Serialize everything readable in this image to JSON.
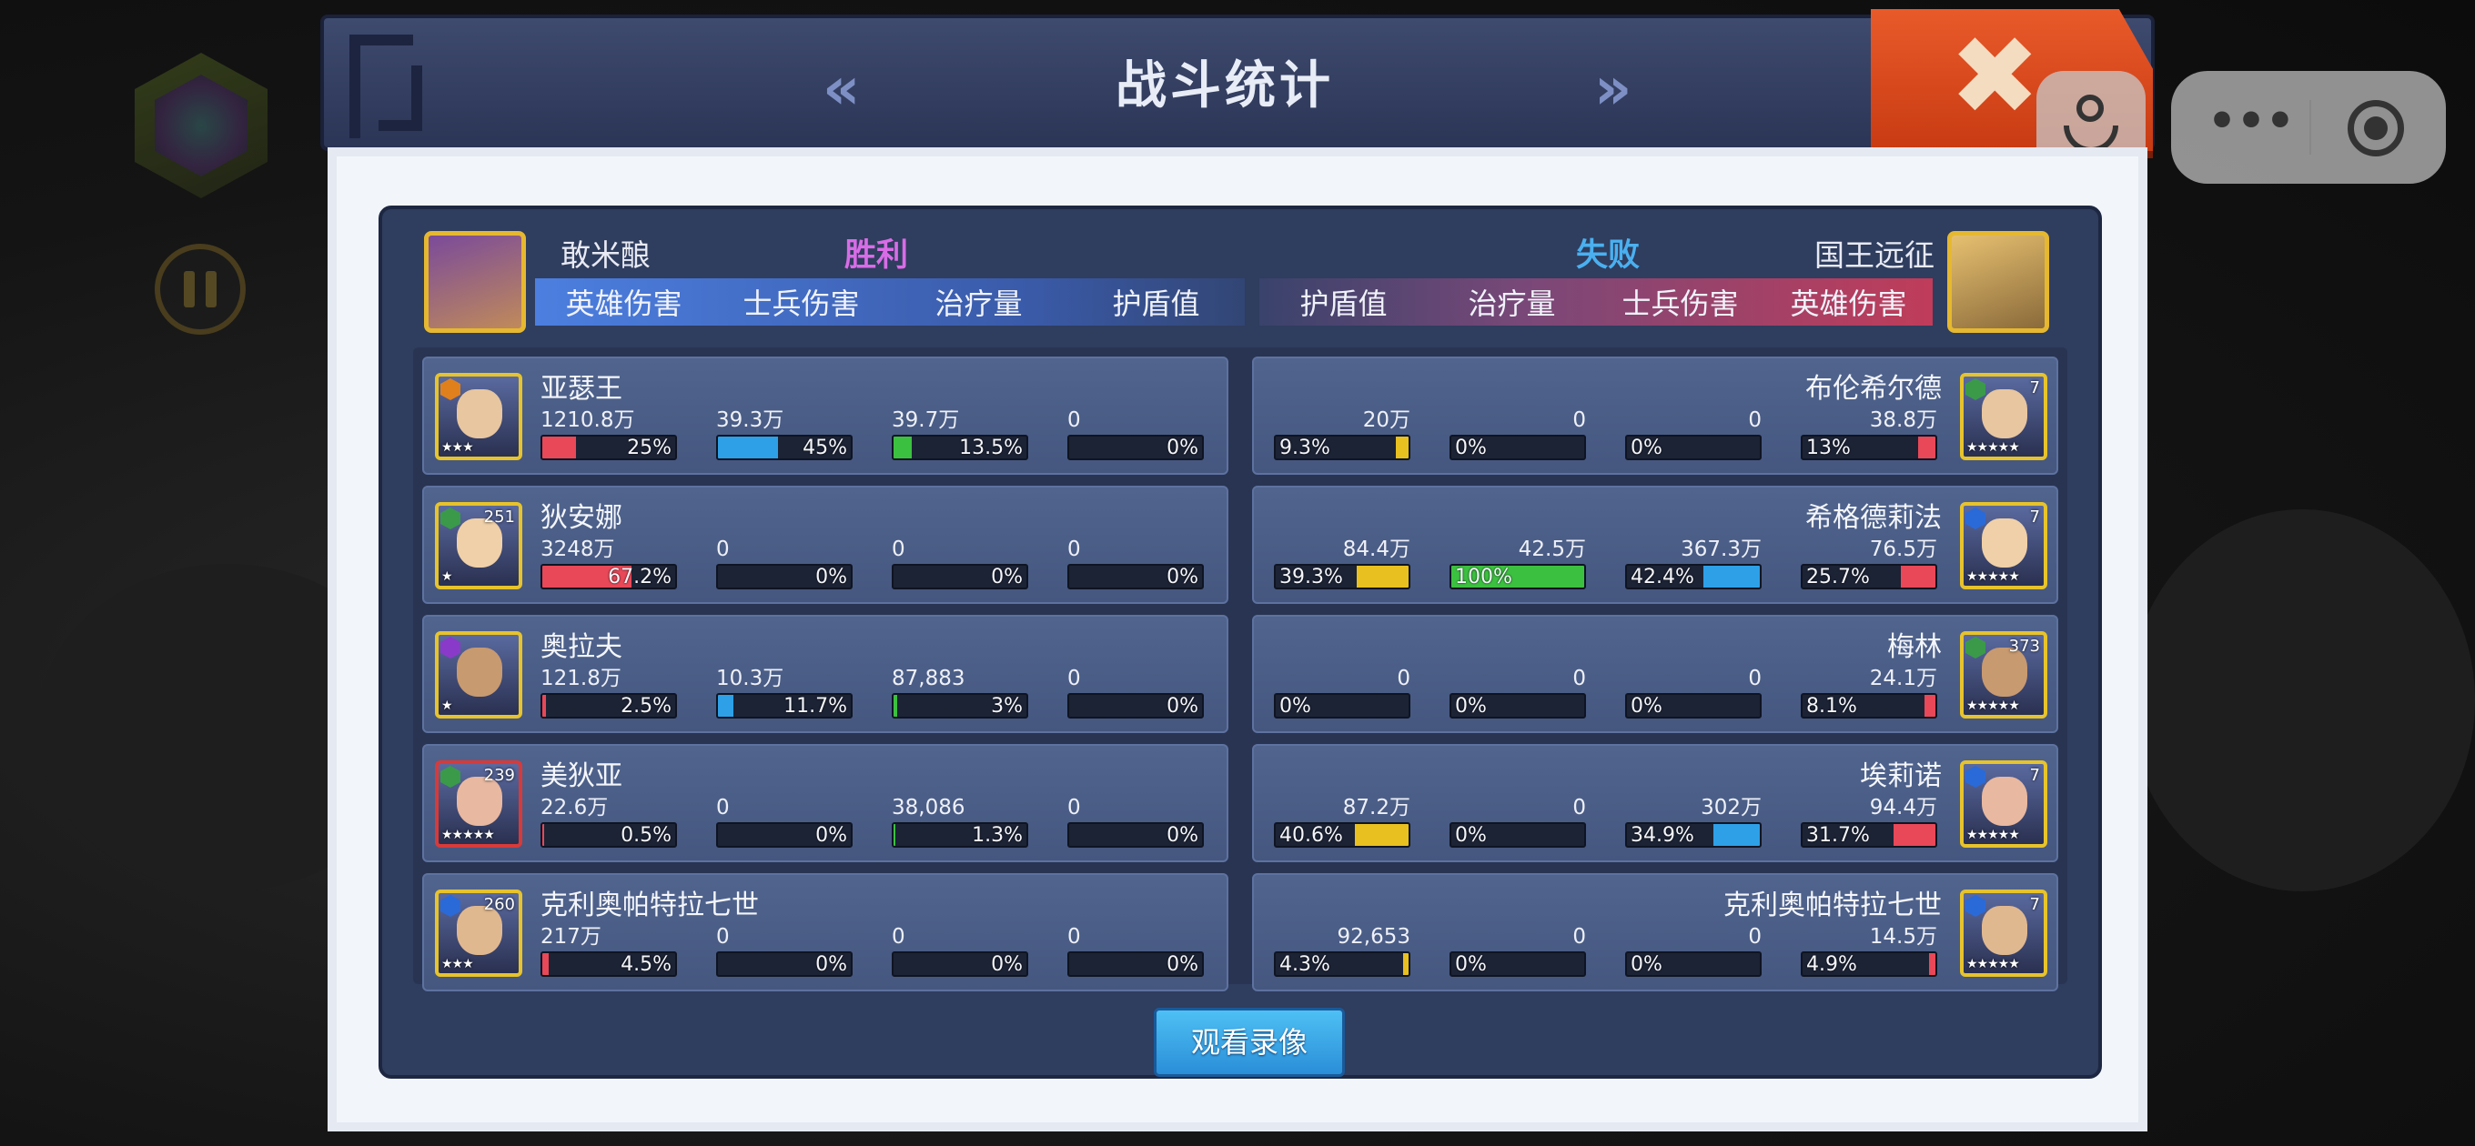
{
  "header": {
    "title": "战斗统计",
    "prev_icon": "double-chevron-left",
    "next_icon": "double-chevron-right",
    "close_icon": "close-x"
  },
  "left_team": {
    "player": "敢米酿",
    "result": "胜利",
    "result_color": "#d86ce6",
    "columns": [
      "英雄伤害",
      "士兵伤害",
      "治疗量",
      "护盾值"
    ]
  },
  "right_team": {
    "player": "国王远征",
    "result": "失败",
    "result_color": "#4ab0f0",
    "columns": [
      "护盾值",
      "治疗量",
      "士兵伤害",
      "英雄伤害"
    ]
  },
  "left_heroes": [
    {
      "name": "亚瑟王",
      "level": "",
      "stars": "★★★",
      "border": "#e7c32c",
      "faction_color": "#e0801c",
      "stats": [
        {
          "value": "1210.8万",
          "pct": "25%",
          "fraction": 0.25,
          "color": "#e84858"
        },
        {
          "value": "39.3万",
          "pct": "45%",
          "fraction": 0.45,
          "color": "#2ea0e8"
        },
        {
          "value": "39.7万",
          "pct": "13.5%",
          "fraction": 0.135,
          "color": "#3cc040"
        },
        {
          "value": "0",
          "pct": "0%",
          "fraction": 0,
          "color": "#e8c020"
        }
      ]
    },
    {
      "name": "狄安娜",
      "level": "251",
      "stars": "★",
      "border": "#e7c32c",
      "faction_color": "#3a9a4a",
      "stats": [
        {
          "value": "3248万",
          "pct": "67.2%",
          "fraction": 0.672,
          "color": "#e84858"
        },
        {
          "value": "0",
          "pct": "0%",
          "fraction": 0,
          "color": "#2ea0e8"
        },
        {
          "value": "0",
          "pct": "0%",
          "fraction": 0,
          "color": "#3cc040"
        },
        {
          "value": "0",
          "pct": "0%",
          "fraction": 0,
          "color": "#e8c020"
        }
      ]
    },
    {
      "name": "奥拉夫",
      "level": "",
      "stars": "★",
      "border": "#e7c32c",
      "faction_color": "#8a3ac8",
      "stats": [
        {
          "value": "121.8万",
          "pct": "2.5%",
          "fraction": 0.025,
          "color": "#e84858"
        },
        {
          "value": "10.3万",
          "pct": "11.7%",
          "fraction": 0.117,
          "color": "#2ea0e8"
        },
        {
          "value": "87,883",
          "pct": "3%",
          "fraction": 0.03,
          "color": "#3cc040"
        },
        {
          "value": "0",
          "pct": "0%",
          "fraction": 0,
          "color": "#e8c020"
        }
      ]
    },
    {
      "name": "美狄亚",
      "level": "239",
      "stars": "★★★★★",
      "border": "#d83a3a",
      "faction_color": "#3a9a4a",
      "stats": [
        {
          "value": "22.6万",
          "pct": "0.5%",
          "fraction": 0.005,
          "color": "#e84858"
        },
        {
          "value": "0",
          "pct": "0%",
          "fraction": 0,
          "color": "#2ea0e8"
        },
        {
          "value": "38,086",
          "pct": "1.3%",
          "fraction": 0.013,
          "color": "#3cc040"
        },
        {
          "value": "0",
          "pct": "0%",
          "fraction": 0,
          "color": "#e8c020"
        }
      ]
    },
    {
      "name": "克利奥帕特拉七世",
      "level": "260",
      "stars": "★★★",
      "border": "#e7c32c",
      "faction_color": "#2a6ad8",
      "stats": [
        {
          "value": "217万",
          "pct": "4.5%",
          "fraction": 0.045,
          "color": "#e84858"
        },
        {
          "value": "0",
          "pct": "0%",
          "fraction": 0,
          "color": "#2ea0e8"
        },
        {
          "value": "0",
          "pct": "0%",
          "fraction": 0,
          "color": "#3cc040"
        },
        {
          "value": "0",
          "pct": "0%",
          "fraction": 0,
          "color": "#e8c020"
        }
      ]
    }
  ],
  "right_heroes": [
    {
      "name": "布伦希尔德",
      "level": "7",
      "stars": "★★★★★",
      "border": "#e7c32c",
      "faction_color": "#3a9a4a",
      "stats": [
        {
          "value": "20万",
          "pct": "9.3%",
          "fraction": 0.093,
          "color": "#e8c020"
        },
        {
          "value": "0",
          "pct": "0%",
          "fraction": 0,
          "color": "#3cc040"
        },
        {
          "value": "0",
          "pct": "0%",
          "fraction": 0,
          "color": "#2ea0e8"
        },
        {
          "value": "38.8万",
          "pct": "13%",
          "fraction": 0.13,
          "color": "#e84858"
        }
      ]
    },
    {
      "name": "希格德莉法",
      "level": "7",
      "stars": "★★★★★",
      "border": "#e7c32c",
      "faction_color": "#2a6ad8",
      "stats": [
        {
          "value": "84.4万",
          "pct": "39.3%",
          "fraction": 0.393,
          "color": "#e8c020"
        },
        {
          "value": "42.5万",
          "pct": "100%",
          "fraction": 1.0,
          "color": "#3cc040"
        },
        {
          "value": "367.3万",
          "pct": "42.4%",
          "fraction": 0.424,
          "color": "#2ea0e8"
        },
        {
          "value": "76.5万",
          "pct": "25.7%",
          "fraction": 0.257,
          "color": "#e84858"
        }
      ]
    },
    {
      "name": "梅林",
      "level": "373",
      "stars": "★★★★★",
      "border": "#e7c32c",
      "faction_color": "#3a9a4a",
      "stats": [
        {
          "value": "0",
          "pct": "0%",
          "fraction": 0,
          "color": "#e8c020"
        },
        {
          "value": "0",
          "pct": "0%",
          "fraction": 0,
          "color": "#3cc040"
        },
        {
          "value": "0",
          "pct": "0%",
          "fraction": 0,
          "color": "#2ea0e8"
        },
        {
          "value": "24.1万",
          "pct": "8.1%",
          "fraction": 0.081,
          "color": "#e84858"
        }
      ]
    },
    {
      "name": "埃莉诺",
      "level": "7",
      "stars": "★★★★★",
      "border": "#e7c32c",
      "faction_color": "#2a6ad8",
      "stats": [
        {
          "value": "87.2万",
          "pct": "40.6%",
          "fraction": 0.406,
          "color": "#e8c020"
        },
        {
          "value": "0",
          "pct": "0%",
          "fraction": 0,
          "color": "#3cc040"
        },
        {
          "value": "302万",
          "pct": "34.9%",
          "fraction": 0.349,
          "color": "#2ea0e8"
        },
        {
          "value": "94.4万",
          "pct": "31.7%",
          "fraction": 0.317,
          "color": "#e84858"
        }
      ]
    },
    {
      "name": "克利奥帕特拉七世",
      "level": "7",
      "stars": "★★★★★",
      "border": "#e7c32c",
      "faction_color": "#2a6ad8",
      "stats": [
        {
          "value": "92,653",
          "pct": "4.3%",
          "fraction": 0.043,
          "color": "#e8c020"
        },
        {
          "value": "0",
          "pct": "0%",
          "fraction": 0,
          "color": "#3cc040"
        },
        {
          "value": "0",
          "pct": "0%",
          "fraction": 0,
          "color": "#2ea0e8"
        },
        {
          "value": "14.5万",
          "pct": "4.9%",
          "fraction": 0.049,
          "color": "#e84858"
        }
      ]
    }
  ],
  "watch_button": "观看录像",
  "miniprogram": {
    "more_icon": "more-dots",
    "close_icon": "target-circle",
    "avatar_icon": "person-icon"
  }
}
